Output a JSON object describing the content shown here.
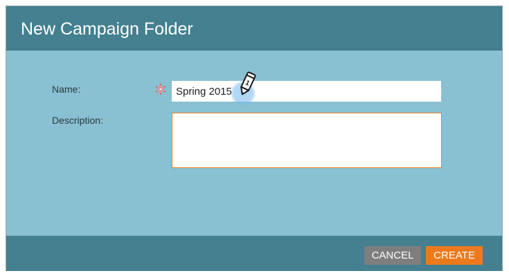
{
  "dialog": {
    "title": "New Campaign Folder"
  },
  "form": {
    "name_label": "Name:",
    "name_value": "Spring 2015",
    "required_marker": "*",
    "description_label": "Description:",
    "description_value": ""
  },
  "footer": {
    "cancel_label": "CANCEL",
    "create_label": "CREATE"
  },
  "annotation": {
    "step_number": "1",
    "icon": "pencil-icon"
  },
  "colors": {
    "header_bg": "#44808f",
    "body_bg": "#89c0d2",
    "cancel_bg": "#7e7e7e",
    "create_bg": "#ec7a1c",
    "focus_border": "#e9801f",
    "required": "#d9534f"
  }
}
